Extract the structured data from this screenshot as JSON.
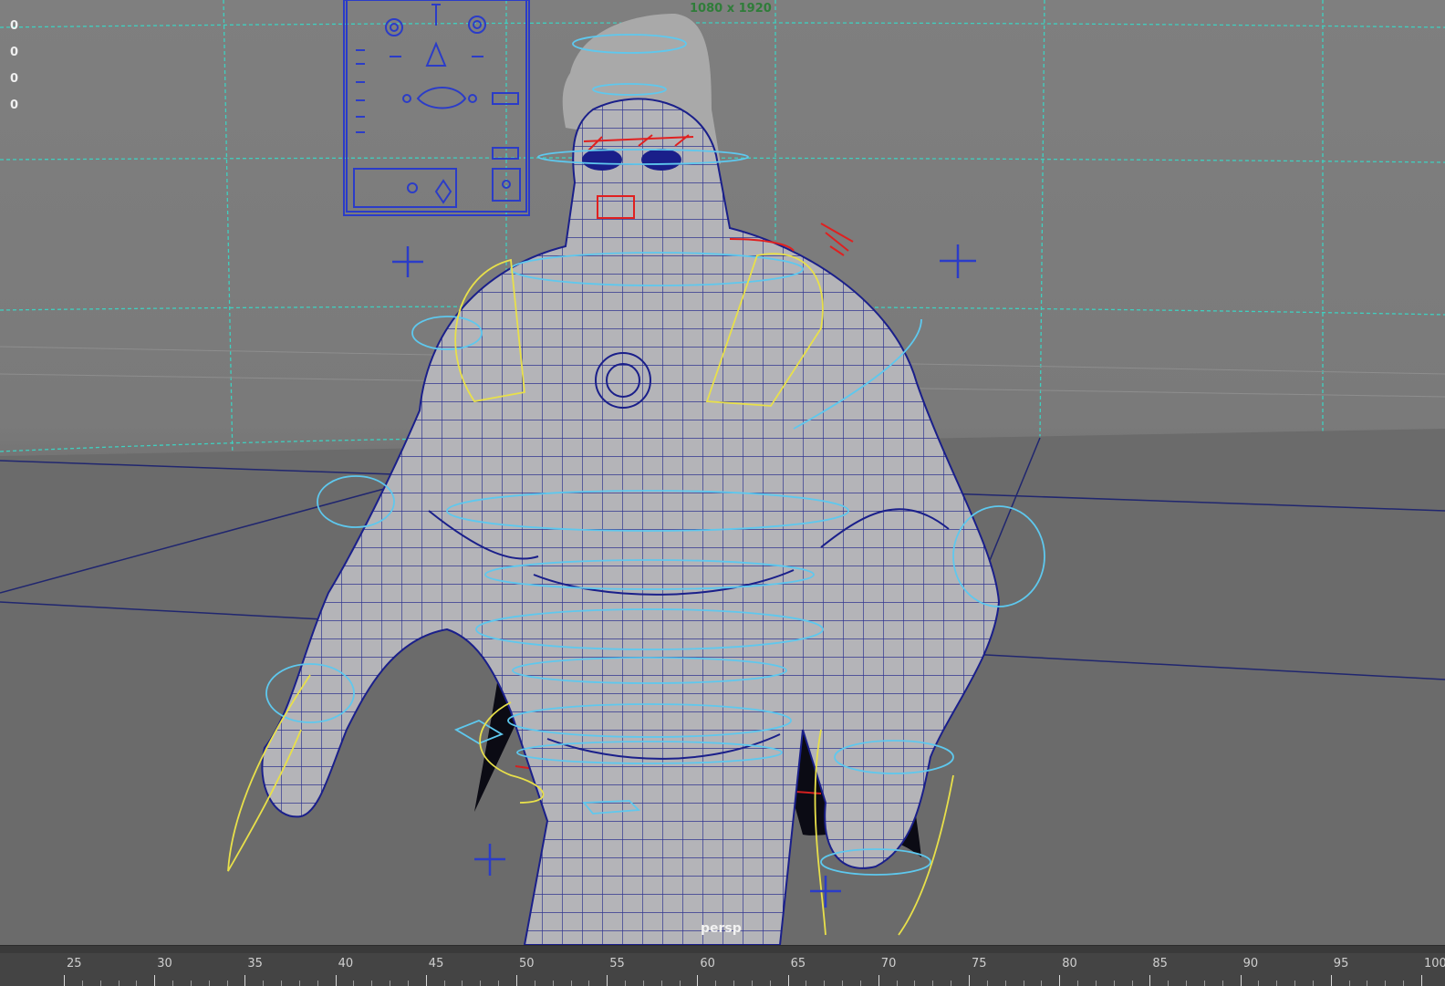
{
  "viewport": {
    "camera_label": "persp",
    "resolution_gate_label": "1080 x 1920",
    "hud_values": [
      "0",
      "0",
      "0",
      "0"
    ]
  },
  "timeline": {
    "tick_labels": [
      "25",
      "30",
      "35",
      "40",
      "45",
      "50",
      "55",
      "60",
      "65",
      "70",
      "75",
      "80",
      "85",
      "90",
      "95",
      "100"
    ]
  },
  "colors": {
    "viewport_bg": "#7b7b7b",
    "wireframe": "#1a1f8a",
    "control_curve_cyan": "#5ec8ee",
    "control_curve_yellow": "#e8e04a",
    "face_controls": "#e02020",
    "grid_dashed": "#3fd0c0",
    "timeline_bg": "#444444"
  },
  "icons": [
    "locator-cross-icon",
    "face-control-panel-icon"
  ]
}
